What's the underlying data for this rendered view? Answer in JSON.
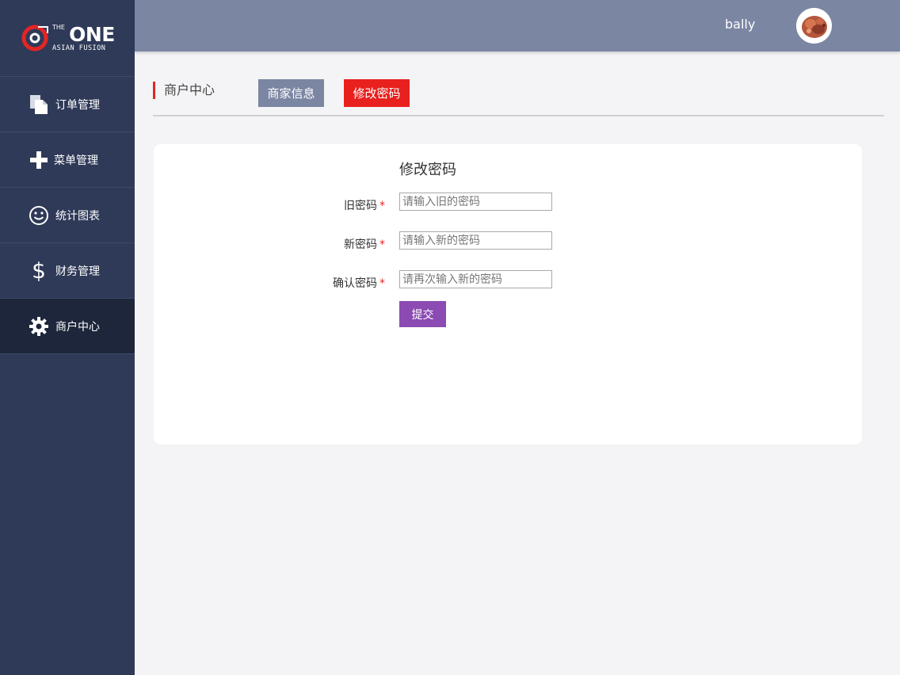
{
  "logo": {
    "title": "ONE",
    "small": "THE",
    "subtitle": "ASIAN FUSION"
  },
  "sidebar": {
    "items": [
      {
        "label": "订单管理",
        "icon": "document-copy-icon"
      },
      {
        "label": "菜单管理",
        "icon": "plus-icon"
      },
      {
        "label": "统计图表",
        "icon": "smiley-icon"
      },
      {
        "label": "财务管理",
        "icon": "dollar-icon"
      },
      {
        "label": "商户中心",
        "icon": "gear-icon",
        "active": true
      }
    ]
  },
  "header": {
    "username": "bally",
    "avatar": "avatar-food-image"
  },
  "page": {
    "title": "商户中心",
    "tabs": [
      {
        "label": "商家信息"
      },
      {
        "label": "修改密码",
        "active": true
      }
    ]
  },
  "form": {
    "title": "修改密码",
    "fields": [
      {
        "label": "旧密码",
        "required_mark": "*",
        "placeholder": "请输入旧的密码",
        "value": ""
      },
      {
        "label": "新密码",
        "required_mark": "*",
        "placeholder": "请输入新的密码",
        "value": ""
      },
      {
        "label": "确认密码",
        "required_mark": "*",
        "placeholder": "请再次输入新的密码",
        "value": ""
      }
    ],
    "submit_label": "提交"
  },
  "colors": {
    "sidebar": "#2f3a58",
    "sidebar_active": "#1e263b",
    "header": "#7b86a3",
    "accent_red": "#e8211e",
    "submit": "#8b4bb3"
  }
}
